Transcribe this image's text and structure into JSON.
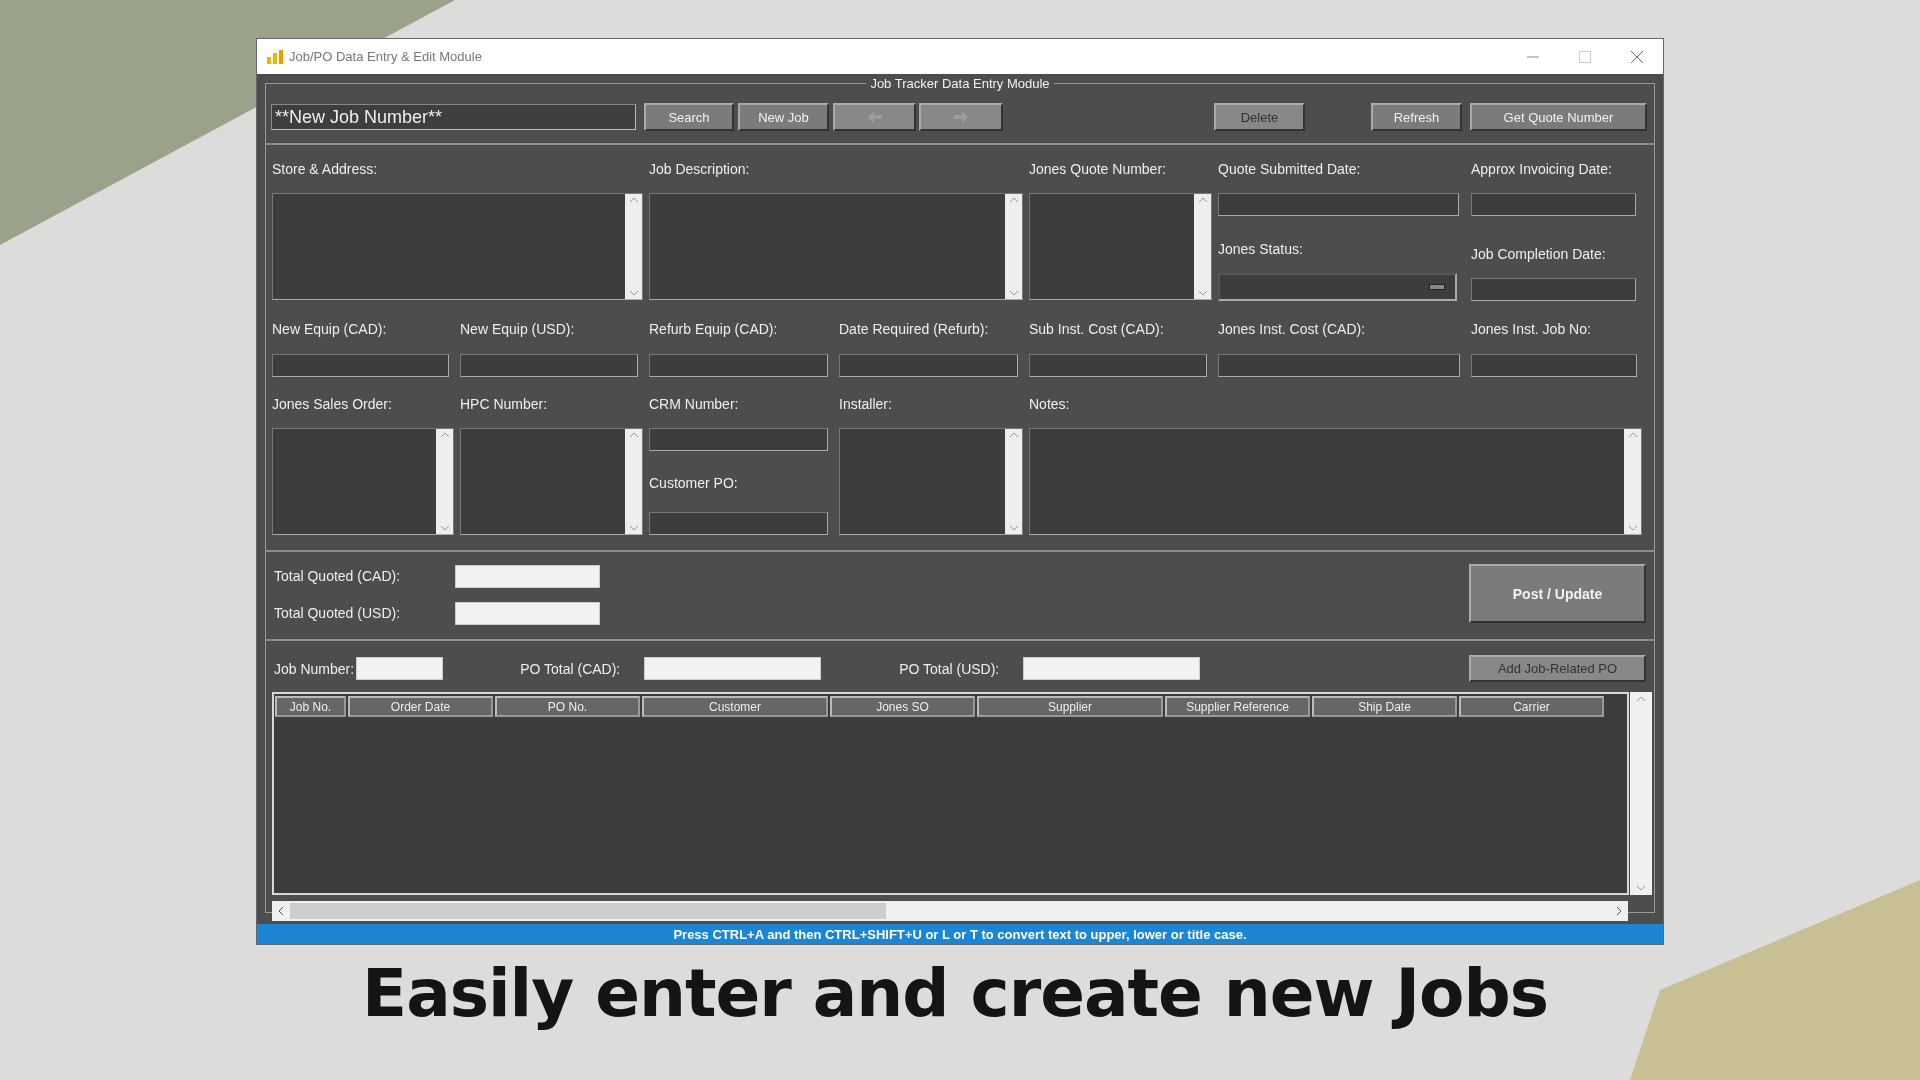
{
  "window": {
    "title": "Job/PO Data Entry & Edit Module"
  },
  "group_title": "Job Tracker Data Entry Module",
  "toolbar": {
    "job_number": {
      "value": "**New Job Number**"
    },
    "buttons": [
      {
        "kind": "text",
        "label": "Search",
        "disabled": false
      },
      {
        "kind": "text",
        "label": "New Job",
        "disabled": false
      },
      {
        "kind": "arrow-left",
        "disabled": true
      },
      {
        "kind": "arrow-right",
        "disabled": true
      },
      {
        "kind": "text",
        "label": "Delete",
        "disabled": true
      },
      {
        "kind": "text",
        "label": "Refresh",
        "disabled": false
      },
      {
        "kind": "text",
        "label": "Get Quote Number",
        "disabled": false
      }
    ]
  },
  "fields": [
    {
      "label": "Store & Address:",
      "kind": "textarea"
    },
    {
      "label": "Job Description:",
      "kind": "textarea"
    },
    {
      "label": "Jones Quote Number:",
      "kind": "textarea"
    },
    {
      "label": "Quote Submitted Date:",
      "kind": "input"
    },
    {
      "label": "Approx Invoicing Date:",
      "kind": "input"
    },
    {
      "label": "Jones Status:",
      "kind": "combo"
    },
    {
      "label": "Job Completion Date:",
      "kind": "input"
    },
    {
      "label": "New Equip (CAD):",
      "kind": "input"
    },
    {
      "label": "New Equip (USD):",
      "kind": "input"
    },
    {
      "label": "Refurb Equip (CAD):",
      "kind": "input"
    },
    {
      "label": "Date Required (Refurb):",
      "kind": "input"
    },
    {
      "label": "Sub Inst. Cost (CAD):",
      "kind": "input"
    },
    {
      "label": "Jones Inst. Cost (CAD):",
      "kind": "input"
    },
    {
      "label": "Jones Inst. Job No:",
      "kind": "input"
    },
    {
      "label": "Jones Sales Order:",
      "kind": "textarea"
    },
    {
      "label": "HPC Number:",
      "kind": "textarea"
    },
    {
      "label": "CRM Number:",
      "kind": "input"
    },
    {
      "label": "Customer PO:",
      "kind": "input"
    },
    {
      "label": "Installer:",
      "kind": "textarea"
    },
    {
      "label": "Notes:",
      "kind": "textarea"
    }
  ],
  "totals": [
    {
      "label": "Total Quoted (CAD):"
    },
    {
      "label": "Total Quoted (USD):"
    }
  ],
  "post_button": {
    "label": "Post / Update"
  },
  "po_bar": {
    "job_number_label": "Job Number:",
    "totals": [
      {
        "label": "PO Total (CAD):"
      },
      {
        "label": "PO Total (USD):"
      }
    ],
    "add_button": {
      "label": "Add Job-Related PO",
      "disabled": true
    }
  },
  "table": {
    "columns": [
      "Job No.",
      "Order Date",
      "PO No.",
      "Customer",
      "Jones SO",
      "Supplier",
      "Supplier Reference",
      "Ship Date",
      "Carrier"
    ]
  },
  "status_bar": "Press CTRL+A and then CTRL+SHIFT+U or L or T to convert text to upper, lower or title case.",
  "caption": "Easily enter and create new Jobs"
}
